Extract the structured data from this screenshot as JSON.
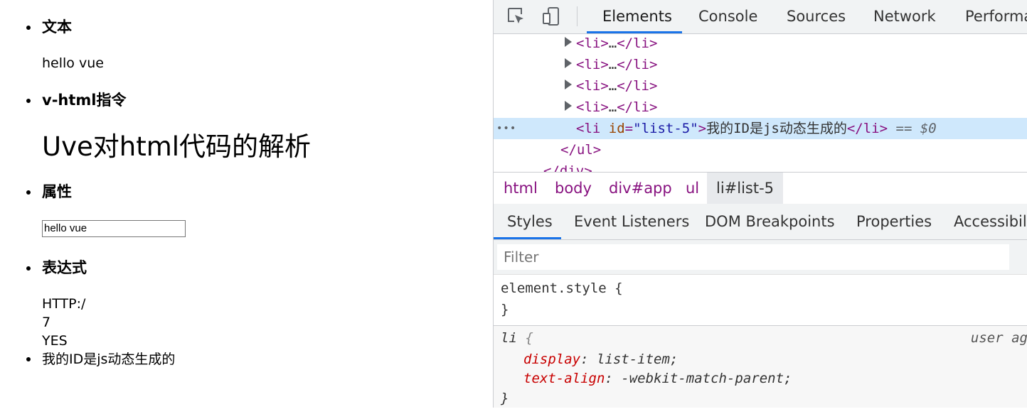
{
  "page": {
    "sections": [
      {
        "heading": "文本",
        "content": "hello vue"
      },
      {
        "heading": "v-html指令",
        "content": "Uve对html代码的解析"
      },
      {
        "heading": "属性",
        "input_value": "hello vue"
      },
      {
        "heading": "表达式",
        "lines": [
          "HTTP:/",
          "7",
          "YES"
        ]
      }
    ],
    "dynamic_item": "我的ID是js动态生成的"
  },
  "devtools": {
    "tabs": [
      "Elements",
      "Console",
      "Sources",
      "Network",
      "Performa"
    ],
    "active_tab": "Elements",
    "dom": {
      "collapsed_items": [
        {
          "open": "<li>",
          "ellipsis": "…",
          "close": "</li>"
        },
        {
          "open": "<li>",
          "ellipsis": "…",
          "close": "</li>"
        },
        {
          "open": "<li>",
          "ellipsis": "…",
          "close": "</li>"
        },
        {
          "open": "<li>",
          "ellipsis": "…",
          "close": "</li>"
        }
      ],
      "selected": {
        "tag_open": "<li",
        "attr_name": "id",
        "attr_eq": "=",
        "attr_value": "\"list-5\"",
        "tag_open_end": ">",
        "text": "我的ID是js动态生成的",
        "tag_close": "</li>",
        "suffix_eq": " == ",
        "suffix_ref": "$0",
        "dots": "•••"
      },
      "ul_close": "</ul>",
      "div_close": "</div>"
    },
    "breadcrumbs": [
      "html",
      "body",
      "div#app",
      "ul",
      "li#list-5"
    ],
    "subtabs": [
      "Styles",
      "Event Listeners",
      "DOM Breakpoints",
      "Properties",
      "Accessibilit"
    ],
    "active_subtab": "Styles",
    "filter_placeholder": "Filter",
    "styles": {
      "element_style_open": "element.style {",
      "element_style_close": "}",
      "ua_selector": "li",
      "ua_open": " {",
      "ua_origin": "user ag",
      "declarations": [
        {
          "prop": "display",
          "value": "list-item;"
        },
        {
          "prop": "text-align",
          "value": "-webkit-match-parent;"
        }
      ],
      "ua_close": "}"
    },
    "colors": {
      "accent": "#1a73e8",
      "tag": "#881280",
      "attr_name": "#994500",
      "attr_value": "#1a1aa6",
      "selection": "#cfe8fc",
      "property": "#c80000"
    }
  }
}
